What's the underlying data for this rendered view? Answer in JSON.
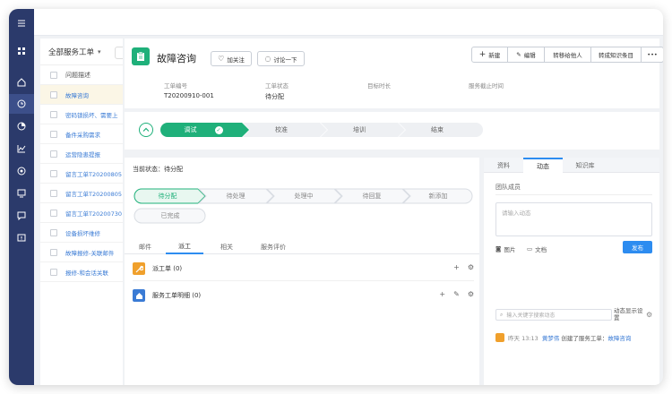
{
  "colors": {
    "sidebar": "#2b3a6b",
    "accent_green": "#1fb07a",
    "accent_blue": "#2d8cf0",
    "link": "#3a7bd5"
  },
  "nav": {
    "icons": [
      "menu-icon",
      "grid-icon",
      "home-icon",
      "clock-icon",
      "pie-chart-icon",
      "line-chart-icon",
      "target-icon",
      "monitor-icon",
      "chat-icon",
      "alert-icon"
    ]
  },
  "list": {
    "filter_label": "全部服务工单",
    "column_header": "问题描述",
    "items": [
      "故障咨询",
      "密码锁损坏、需要上",
      "备件采购需求",
      "运营隐患提报",
      "留言工单T20200805",
      "留言工单T20200805",
      "留言工单T20200730",
      "设备损坏维修",
      "故障报修-关联邮件",
      "报修-和会话关联"
    ]
  },
  "ticket": {
    "title": "故障咨询",
    "follow_label": "加关注",
    "discuss_label": "讨论一下",
    "toolbar": {
      "new": "新建",
      "edit": "编辑",
      "transfer": "转移给他人",
      "to_kb": "转成知识条目",
      "more": "•••"
    },
    "fields": [
      {
        "label": "工单编号",
        "value": "T20200910-001"
      },
      {
        "label": "工单状态",
        "value": "待分配"
      },
      {
        "label": "目标时长",
        "value": ""
      },
      {
        "label": "服务截止时间",
        "value": ""
      }
    ]
  },
  "stages": [
    "调试",
    "校准",
    "培训",
    "结束"
  ],
  "status": {
    "current_label": "当前状态：",
    "current_value": "待分配",
    "steps": [
      "待分配",
      "待处理",
      "处理中",
      "待回复",
      "新添加",
      "已完成"
    ]
  },
  "left_tabs": [
    "邮件",
    "派工",
    "相关",
    "服务评价"
  ],
  "sections": [
    {
      "label": "派工单",
      "count": "(0)"
    },
    {
      "label": "服务工单明细",
      "count": "(0)"
    }
  ],
  "right_tabs": [
    "资料",
    "动态",
    "知识库"
  ],
  "team_label": "团队成员",
  "comment_placeholder": "请输入动态",
  "attach": {
    "image": "图片",
    "doc": "文档"
  },
  "publish_label": "发布",
  "search_placeholder": "输入关键字搜索动态",
  "only_me": "动态显示设置",
  "activity": {
    "time": "昨天 13:13",
    "user": "黄梦伟",
    "action": "创建了服务工单：",
    "target": "故障咨询"
  }
}
